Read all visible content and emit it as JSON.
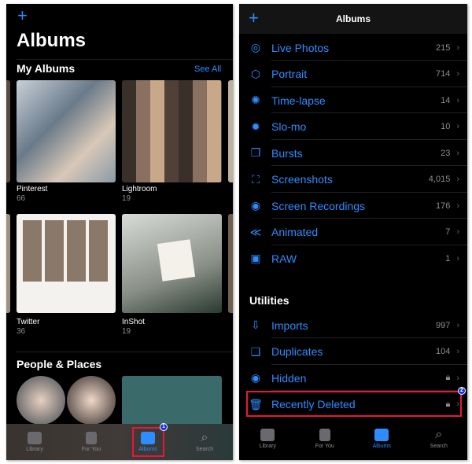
{
  "left": {
    "add_icon": "plus-icon",
    "title": "Albums",
    "my_albums": {
      "heading": "My Albums",
      "see_all": "See All",
      "albums": [
        {
          "name": "Pinterest",
          "count": "66"
        },
        {
          "name": "Lightroom",
          "count": "19"
        },
        {
          "name": "Twitter",
          "count": "36"
        },
        {
          "name": "InShot",
          "count": "19"
        }
      ]
    },
    "people_places": {
      "heading": "People & Places"
    },
    "tabs": [
      {
        "label": "Library",
        "icon": "photo-stack-icon"
      },
      {
        "label": "For You",
        "icon": "for-you-icon"
      },
      {
        "label": "Albums",
        "icon": "albums-icon",
        "active": true
      },
      {
        "label": "Search",
        "icon": "search-icon"
      }
    ],
    "step_badge": "1"
  },
  "right": {
    "add_icon": "plus-icon",
    "title": "Albums",
    "media_types": [
      {
        "label": "Live Photos",
        "count": "215",
        "icon": "live-photo-icon"
      },
      {
        "label": "Portrait",
        "count": "714",
        "icon": "cube-icon"
      },
      {
        "label": "Time-lapse",
        "count": "14",
        "icon": "timelapse-icon"
      },
      {
        "label": "Slo-mo",
        "count": "10",
        "icon": "slomo-icon"
      },
      {
        "label": "Bursts",
        "count": "23",
        "icon": "bursts-icon"
      },
      {
        "label": "Screenshots",
        "count": "4,015",
        "icon": "screenshot-icon"
      },
      {
        "label": "Screen Recordings",
        "count": "176",
        "icon": "record-icon"
      },
      {
        "label": "Animated",
        "count": "7",
        "icon": "animated-icon"
      },
      {
        "label": "RAW",
        "count": "1",
        "icon": "raw-icon"
      }
    ],
    "utilities_heading": "Utilities",
    "utilities": [
      {
        "label": "Imports",
        "count": "997",
        "icon": "import-icon"
      },
      {
        "label": "Duplicates",
        "count": "104",
        "icon": "duplicates-icon"
      },
      {
        "label": "Hidden",
        "count": "",
        "icon": "eye-slash-icon",
        "locked": true
      },
      {
        "label": "Recently Deleted",
        "count": "",
        "icon": "trash-icon",
        "locked": true
      }
    ],
    "tabs": [
      {
        "label": "Library"
      },
      {
        "label": "For You"
      },
      {
        "label": "Albums",
        "active": true
      },
      {
        "label": "Search"
      }
    ],
    "step_badge": "2"
  },
  "colors": {
    "accent": "#2f8cff",
    "highlight": "#e8163a"
  }
}
